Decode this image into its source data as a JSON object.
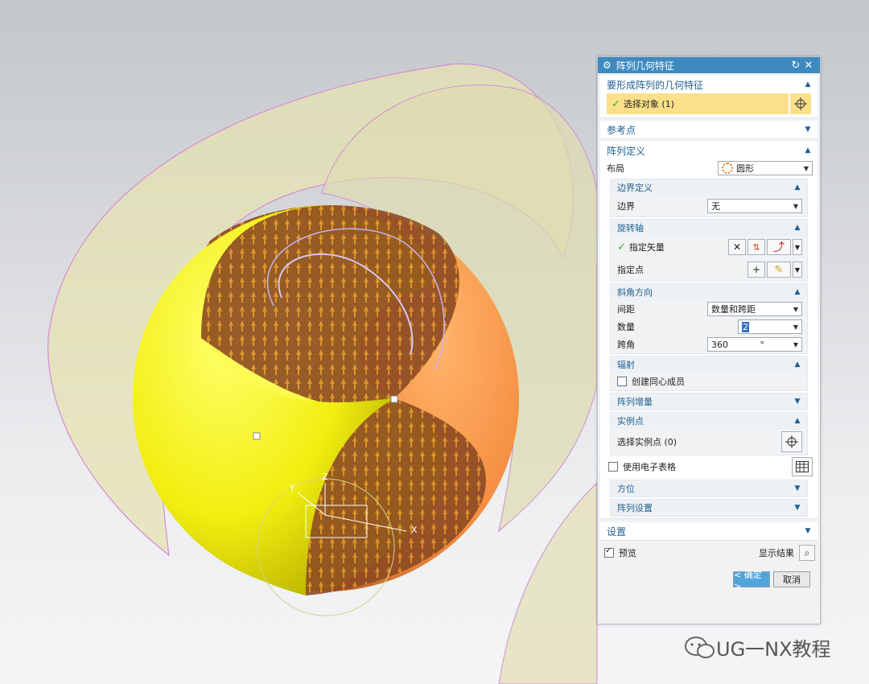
{
  "dialog": {
    "title": "阵列几何特征",
    "features_group": {
      "title": "要形成阵列的几何特征",
      "select_label": "选择对象 (1)"
    },
    "ref_point_group": {
      "title": "参考点"
    },
    "pattern_def": {
      "title": "阵列定义",
      "layout_label": "布局",
      "layout_value": "圆形",
      "boundary": {
        "title": "边界定义",
        "label": "边界",
        "value": "无"
      },
      "rotation_axis": {
        "title": "旋转轴",
        "vector_label": "指定矢量",
        "point_label": "指定点"
      },
      "angular": {
        "title": "斜角方向",
        "spacing_label": "间距",
        "spacing_value": "数量和跨距",
        "count_label": "数量",
        "count_value": "2",
        "span_label": "跨角",
        "span_value": "360",
        "span_unit": "°"
      },
      "radiate": {
        "title": "辐射",
        "concentric_label": "创建同心成员"
      },
      "increment": {
        "title": "阵列增量"
      },
      "instance": {
        "title": "实例点",
        "select_label": "选择实例点 (0)"
      },
      "spreadsheet_label": "使用电子表格",
      "orientation": {
        "title": "方位"
      },
      "settings": {
        "title": "阵列设置"
      }
    },
    "settings_group": {
      "title": "设置"
    },
    "preview_label": "预览",
    "show_result_label": "显示结果",
    "ok_label": "< 确定 >",
    "cancel_label": "取消"
  },
  "viewport": {
    "axis_x": "X",
    "axis_y": "Y",
    "axis_z": "Z"
  },
  "watermark": {
    "text": "UG一NX教程"
  },
  "colors": {
    "title_bar": "#3d8ac0",
    "group_title": "#1e5f93",
    "highlight": "#fbe08a",
    "ok_button": "#52a5d8"
  }
}
